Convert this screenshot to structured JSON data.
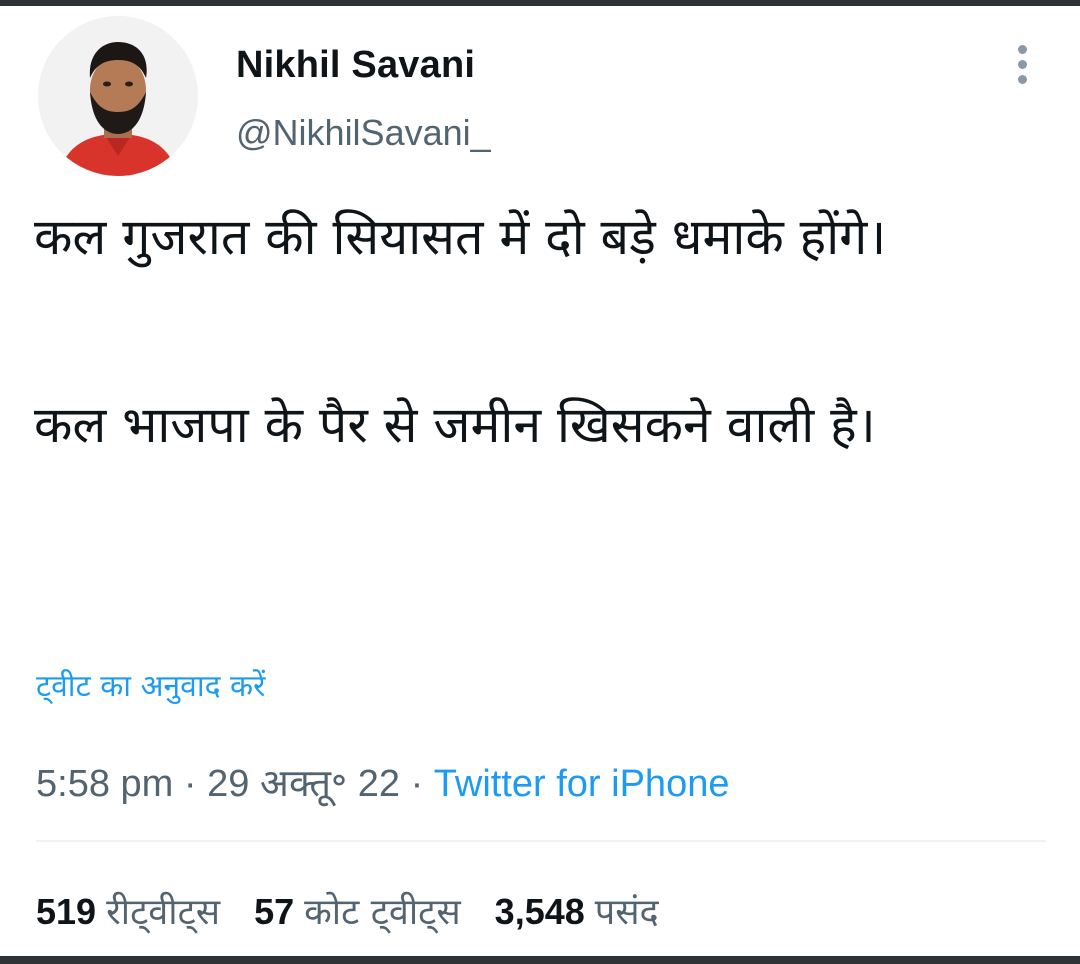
{
  "author": {
    "display_name": "Nikhil Savani",
    "handle": "@NikhilSavani_"
  },
  "tweet": {
    "line1": "कल गुजरात की सियासत में दो बड़े धमाके होंगे।",
    "line2": "कल भाजपा के पैर से जमीन खिसकने वाली है।"
  },
  "translate_label": "ट्वीट का अनुवाद करें",
  "meta": {
    "time": "5:58 pm",
    "date": "29 अक्तू॰ 22",
    "separator": "·",
    "source": "Twitter for iPhone"
  },
  "stats": {
    "retweets_count": "519",
    "retweets_label": "रीट्वीट्स",
    "quotes_count": "57",
    "quotes_label": "कोट ट्वीट्स",
    "likes_count": "3,548",
    "likes_label": "पसंद"
  },
  "icons": {
    "more": "more-vertical-icon"
  },
  "colors": {
    "link": "#1d9bf0",
    "muted": "#536471",
    "text": "#0f1419"
  }
}
